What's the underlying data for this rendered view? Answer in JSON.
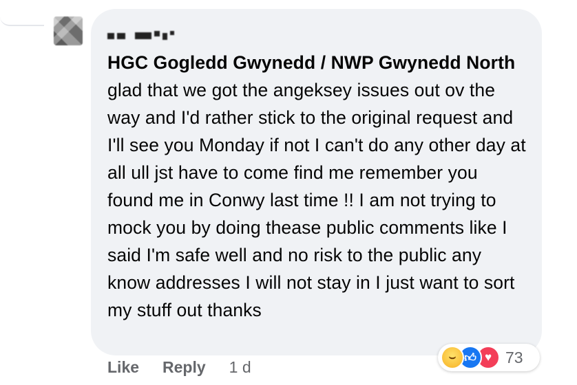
{
  "comment": {
    "mention": "HGC Gogledd Gwynedd / NWP Gwynedd North",
    "body": " glad that we got the angeksey issues out ov the way and I'd rather stick to the original request and I'll see you Monday if not I can't do any other day at all ull jst have to come find me remember you found me in Conwy last time !! I am not trying to mock you by doing thease public comments like I said I'm safe well and no risk to the public any know addresses I will not stay in I just want to sort my stuff out thanks"
  },
  "reactions": {
    "icons": [
      "haha-icon",
      "like-icon",
      "love-icon"
    ],
    "count": "73",
    "colors": {
      "like": "#1877f2",
      "love": "#f33e58",
      "haha": "#f7b125"
    }
  },
  "actions": {
    "like_label": "Like",
    "reply_label": "Reply",
    "timestamp": "1 d"
  },
  "colors": {
    "bubble": "#f0f2f5",
    "secondary_text": "#65676b",
    "primary_text": "#050505"
  }
}
